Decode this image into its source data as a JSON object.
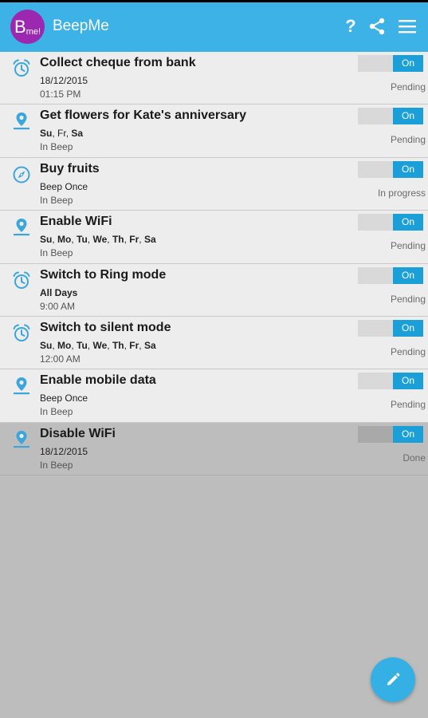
{
  "app": {
    "logo_main": "B",
    "logo_sub": "me!",
    "title": "BeepMe",
    "help_glyph": "?",
    "bar_color": "#3cb2e6",
    "logo_color": "#9c27b0"
  },
  "actions": {
    "help": "help-icon",
    "share": "share-icon",
    "menu": "menu-icon"
  },
  "items": [
    {
      "icon": "alarm-clock-icon",
      "title": "Collect cheque from bank",
      "days": [],
      "line2": "18/12/2015",
      "line3": "01:15 PM",
      "toggle": "On",
      "status": "Pending",
      "done": false
    },
    {
      "icon": "location-pin-icon",
      "title": "Get flowers for Kate's anniversary",
      "days": [
        {
          "d": "Su",
          "bold": true
        },
        {
          "d": "Fr",
          "bold": false
        },
        {
          "d": "Sa",
          "bold": true
        }
      ],
      "line2": "",
      "line3": "In Beep",
      "toggle": "On",
      "status": "Pending",
      "done": false
    },
    {
      "icon": "compass-icon",
      "title": "Buy fruits",
      "days": [],
      "line2": "Beep Once",
      "line3": "In Beep",
      "toggle": "On",
      "status": "In progress",
      "done": false
    },
    {
      "icon": "location-pin-icon",
      "title": "Enable WiFi",
      "days": [
        {
          "d": "Su",
          "bold": true
        },
        {
          "d": "Mo",
          "bold": true
        },
        {
          "d": "Tu",
          "bold": true
        },
        {
          "d": "We",
          "bold": true
        },
        {
          "d": "Th",
          "bold": true
        },
        {
          "d": "Fr",
          "bold": true
        },
        {
          "d": "Sa",
          "bold": true
        }
      ],
      "line2": "",
      "line3": "In Beep",
      "toggle": "On",
      "status": "Pending",
      "done": false
    },
    {
      "icon": "alarm-clock-icon",
      "title": "Switch to Ring mode",
      "days": [
        {
          "d": "All Days",
          "bold": true
        }
      ],
      "line2": "",
      "line3": "9:00 AM",
      "toggle": "On",
      "status": "Pending",
      "done": false
    },
    {
      "icon": "alarm-clock-icon",
      "title": "Switch to silent mode",
      "days": [
        {
          "d": "Su",
          "bold": true
        },
        {
          "d": "Mo",
          "bold": true
        },
        {
          "d": "Tu",
          "bold": true
        },
        {
          "d": "We",
          "bold": true
        },
        {
          "d": "Th",
          "bold": true
        },
        {
          "d": "Fr",
          "bold": true
        },
        {
          "d": "Sa",
          "bold": true
        }
      ],
      "line2": "",
      "line3": "12:00 AM",
      "toggle": "On",
      "status": "Pending",
      "done": false
    },
    {
      "icon": "location-pin-icon",
      "title": "Enable mobile data",
      "days": [],
      "line2": "Beep Once",
      "line3": "In Beep",
      "toggle": "On",
      "status": "Pending",
      "done": false
    },
    {
      "icon": "location-pin-icon",
      "title": "Disable WiFi",
      "days": [],
      "line2": "18/12/2015",
      "line3": "In Beep",
      "toggle": "On",
      "status": "Done",
      "done": true
    }
  ],
  "fab": {
    "icon": "pencil-icon",
    "color": "#34b0e5"
  }
}
